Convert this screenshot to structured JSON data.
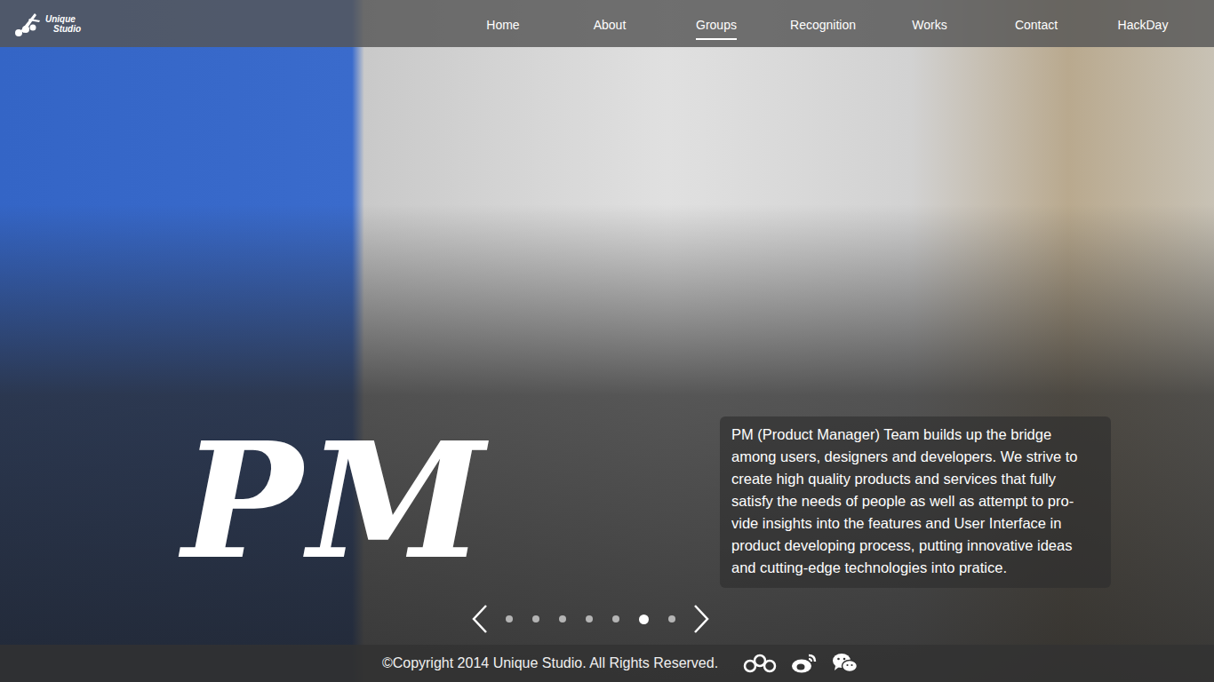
{
  "header": {
    "logo": {
      "lines": [
        "Unique",
        "Studio"
      ]
    },
    "nav": [
      {
        "label": "Home",
        "selected": false
      },
      {
        "label": "About",
        "selected": false
      },
      {
        "label": "Groups",
        "selected": true
      },
      {
        "label": "Recognition",
        "selected": false
      },
      {
        "label": "Works",
        "selected": false
      },
      {
        "label": "Contact",
        "selected": false
      },
      {
        "label": "HackDay",
        "selected": false
      }
    ]
  },
  "hero": {
    "title": "PM",
    "description": " PM (Product Manager) Team builds up the bridge among users, designers and developers. We strive to create high quality products and services that fully satisfy the needs of people as well as attempt to pro-vide insights into the features and User Interface in product developing process, putting innovative ideas and cutting-edge technologies into pratice."
  },
  "carousel": {
    "dots": [
      {
        "selected": false
      },
      {
        "selected": false
      },
      {
        "selected": false
      },
      {
        "selected": false
      },
      {
        "selected": false
      },
      {
        "selected": true
      },
      {
        "selected": false
      }
    ]
  },
  "footer": {
    "copyright": "©Copyright 2014 Unique Studio. All Rights Reserved."
  }
}
